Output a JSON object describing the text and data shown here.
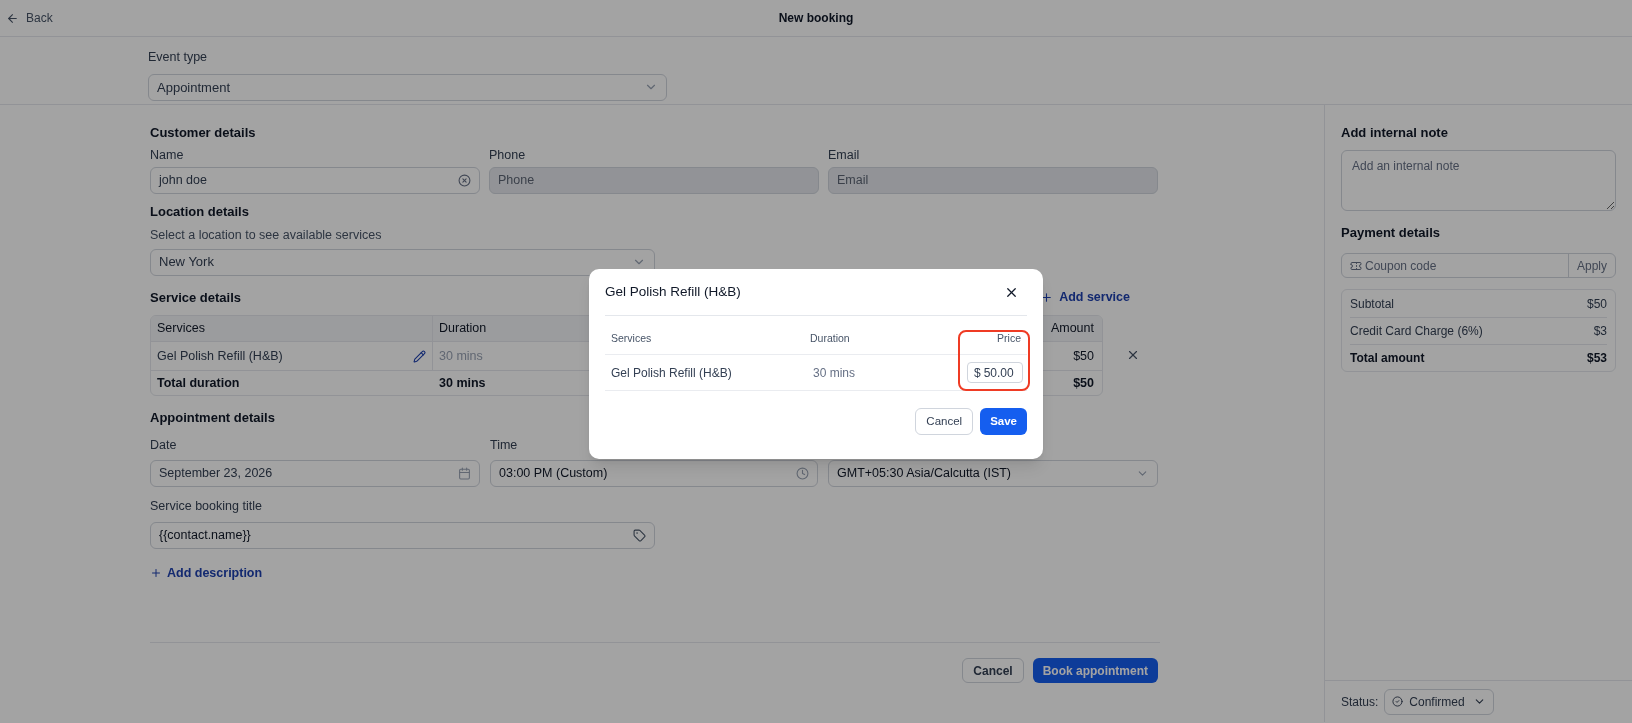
{
  "header": {
    "back": "Back",
    "title": "New booking"
  },
  "event_type": {
    "label": "Event type",
    "value": "Appointment"
  },
  "customer": {
    "heading": "Customer details",
    "fields": [
      {
        "label": "Name",
        "value": "john doe",
        "disabled": false
      },
      {
        "label": "Phone",
        "placeholder": "Phone",
        "disabled": true
      },
      {
        "label": "Email",
        "placeholder": "Email",
        "disabled": true
      }
    ]
  },
  "location": {
    "heading": "Location details",
    "hint": "Select a location to see available services",
    "value": "New York"
  },
  "service": {
    "heading": "Service details",
    "add": "Add service",
    "columns": [
      "Services",
      "Duration",
      "Amount"
    ],
    "rows": [
      {
        "service": "Gel Polish Refill (H&B)",
        "duration": "30 mins",
        "amount": "$50"
      }
    ],
    "total": {
      "label": "Total duration",
      "duration": "30 mins",
      "amount": "$50"
    }
  },
  "appointment": {
    "heading": "Appointment details",
    "date": {
      "label": "Date",
      "value": "September 23, 2026"
    },
    "time": {
      "label": "Time",
      "value": "03:00 PM (Custom)"
    },
    "timezone": {
      "value": "GMT+05:30 Asia/Calcutta (IST)"
    },
    "title": {
      "label": "Service booking title",
      "value": "{{contact.name}}"
    },
    "add_description": "Add description"
  },
  "footer": {
    "cancel": "Cancel",
    "submit": "Book appointment"
  },
  "sidebar": {
    "note": {
      "heading": "Add internal note",
      "placeholder": "Add an internal note"
    },
    "payment": {
      "heading": "Payment details",
      "coupon_placeholder": "Coupon code",
      "apply": "Apply",
      "lines": [
        {
          "label": "Subtotal",
          "value": "$50",
          "total": false
        },
        {
          "label": "Credit Card Charge (6%)",
          "value": "$3",
          "total": false
        },
        {
          "label": "Total amount",
          "value": "$53",
          "total": true
        }
      ]
    },
    "status": {
      "label": "Status:",
      "value": "Confirmed"
    }
  },
  "modal": {
    "title": "Gel Polish Refill (H&B)",
    "columns": [
      "Services",
      "Duration",
      "Price"
    ],
    "price_highlighted": true,
    "row": {
      "service": "Gel Polish Refill (H&B)",
      "duration": "30 mins",
      "currency": "$",
      "price": "50.00"
    },
    "buttons": {
      "cancel": "Cancel",
      "save": "Save"
    }
  }
}
